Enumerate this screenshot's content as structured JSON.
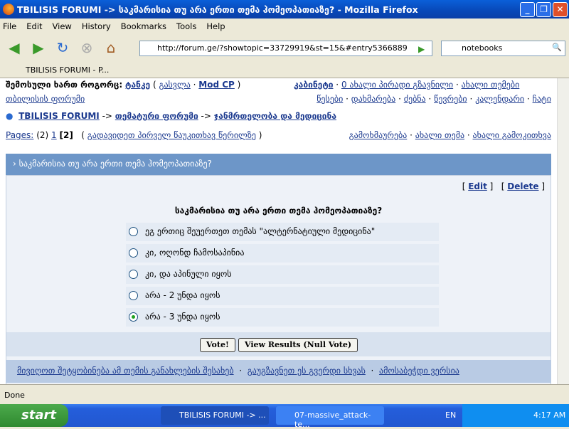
{
  "window": {
    "title": "TBILISIS FORUMI -> საკმარისია თუ არა ერთი თემა ჰომეოპათიაზე? - Mozilla Firefox"
  },
  "menu": [
    "File",
    "Edit",
    "View",
    "History",
    "Bookmarks",
    "Tools",
    "Help"
  ],
  "nav": {
    "url": "http://forum.ge/?showtopic=33729919&st=15&#entry5366889",
    "search": "notebooks"
  },
  "tab": {
    "label": "TBILISIS FORUMI - P..."
  },
  "user": {
    "logged_as": "შემოსული ხართ როგორც:",
    "name": "ტანკე",
    "logout": "გასვლა",
    "modcp": "Mod CP",
    "cabinet": "კაბინეტი",
    "pm": "0 ახალი პირადი გზავნილი",
    "new_topics": "ახალი თემები"
  },
  "forum_name": "თბილისის ფორუმი",
  "links": [
    "წესები",
    "დახმარება",
    "ძებნა",
    "წევრები",
    "კალენდარი",
    "ჩატი"
  ],
  "breadcrumb": {
    "root": "TBILISIS FORUMI",
    "sep": "->",
    "cat": "თემატური ფორუმი",
    "forum": "ჯანმრთელობა და მედიცინა"
  },
  "pages": {
    "label": "Pages:",
    "count": "(2)",
    "p1": "1",
    "current": "[2]",
    "unread": "გადავიდეთ პირველ წაუკითხავ წერილზე",
    "reply": "გამოხმაურება",
    "new_topic": "ახალი თემა",
    "new_poll": "ახალი გამოკითხვა"
  },
  "topic": {
    "title": "საკმარისია თუ არა ერთი თემა ჰომეოპათიაზე?"
  },
  "poll": {
    "edit": "Edit",
    "delete": "Delete",
    "question": "საკმარისია თუ არა ერთი თემა ჰომეოპათიაზე?",
    "options": [
      {
        "label": "ეგ ერთიც შეუერთეთ თემას \"ალტერნატიული მედიცინა\"",
        "selected": false
      },
      {
        "label": "კი, ოღონდ ჩამოსაპინია",
        "selected": false
      },
      {
        "label": "კი, და აპინული იყოს",
        "selected": false
      },
      {
        "label": "არა - 2 უნდა იყოს",
        "selected": false
      },
      {
        "label": "არა - 3 უნდა იყოს",
        "selected": true
      }
    ],
    "vote": "Vote!",
    "results": "View Results (Null Vote)"
  },
  "footer": [
    "მივიღოთ შეტყობინება ამ თემის განახლების შესახებ",
    "გაუგზავნეთ ეს გვერდი სხვას",
    "ამოსაბეჭდი ვერსია"
  ],
  "status": "Done",
  "taskbar": {
    "start": "start",
    "tasks": [
      "TBILISIS FORUMI -> ...",
      "07-massive_attack-te..."
    ],
    "lang": "EN",
    "clock": "4:17 AM"
  }
}
